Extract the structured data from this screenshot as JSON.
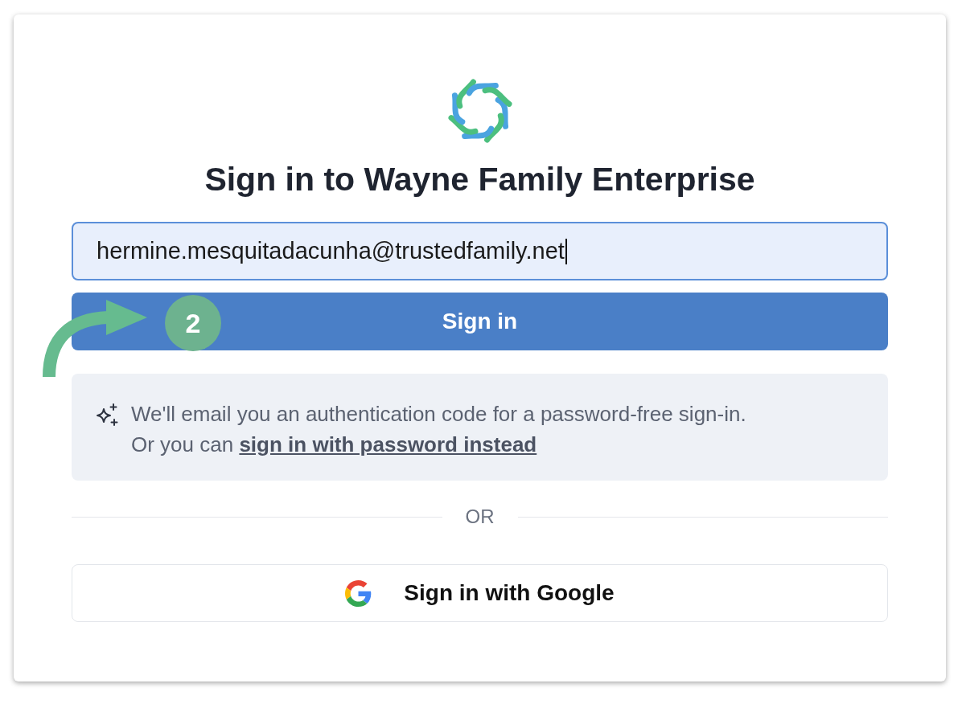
{
  "title": "Sign in to Wayne Family Enterprise",
  "email_field": {
    "value": "hermine.mesquitadacunha@trustedfamily.net",
    "focused": true
  },
  "sign_in_button": {
    "label": "Sign in"
  },
  "info": {
    "text": "We'll email you an authentication code for a password-free sign-in.",
    "prefix": "Or you can",
    "link": "sign in with password instead"
  },
  "divider": {
    "label": "OR"
  },
  "google_button": {
    "label": "Sign in with Google"
  },
  "annotation": {
    "step": "2"
  }
}
